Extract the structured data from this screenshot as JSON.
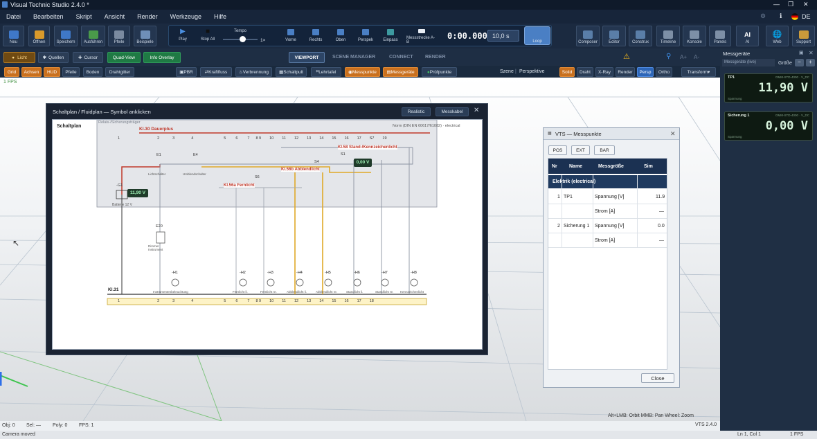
{
  "window": {
    "title": "Visual Technic Studio 2.4.0 *"
  },
  "menu": [
    "Datei",
    "Bearbeiten",
    "Skript",
    "Ansicht",
    "Render",
    "Werkzeuge",
    "Hilfe"
  ],
  "lang": "DE",
  "toolbar": {
    "left": [
      "Neu",
      "Öffnen",
      "Speichern",
      "Ausführen",
      "Pfeile",
      "Beispiele"
    ],
    "transport": [
      "Play",
      "Stop All",
      "Vorne",
      "Rechts",
      "Oben",
      "Perspek",
      "Einpass",
      "Messstrecke A-B"
    ],
    "tempo_label": "Tempo",
    "tempo_value": "1×",
    "time": "0:00.000",
    "duration": "10,0 s",
    "loop": "Loop",
    "right": [
      "Composer",
      "Editor",
      "Construx",
      "Timeline",
      "Konsole",
      "Panels",
      "AI",
      "Web",
      "Support"
    ]
  },
  "row2": {
    "licht": "Licht",
    "quellen": "Quellen",
    "cursor": "Cursor",
    "quadview": "Quad-View",
    "infooverlay": "Info Overlay",
    "tabs": [
      "VIEWPORT",
      "SCENE MANAGER",
      "CONNECT",
      "RENDER"
    ]
  },
  "row3": {
    "left": [
      "Grid",
      "Achsen",
      "HUD",
      "Pfeile",
      "Boden",
      "Drahtgitter"
    ],
    "mid": [
      "PBR",
      "Kraftfluss",
      "Verbrennung",
      "Schaltpult",
      "Lehrtafel",
      "Messpunkte",
      "Messgeräte",
      "Prüfpunkte"
    ],
    "szene": "Szene",
    "perspektive": "Perspektive",
    "modes": [
      "Solid",
      "Draht",
      "X-Ray",
      "Render",
      "Persp",
      "Ortho"
    ],
    "transform": "Transform"
  },
  "viewport": {
    "fps": "1 FPS",
    "hint": "Alt+LMB: Orbit   MMB: Pan   Wheel: Zoom",
    "version": "VTS 2.4.0"
  },
  "status": {
    "obj": "Obj: 0",
    "sel": "Sel: —",
    "poly": "Poly: 0",
    "fps": "FPS: 1",
    "message": "Camera moved",
    "lncol": "Ln 1, Col 1",
    "fps2": "1 FPS"
  },
  "panel": {
    "title": "Messgeräte",
    "size": "Größe",
    "subtitle": "Messgeräte (live)",
    "meters": [
      {
        "name": "TP1",
        "device": "DMM-STD-4000 · V_DC",
        "value": "11,90 V",
        "sub": "Spannung"
      },
      {
        "name": "Sicherung 1",
        "device": "DMM-STD-4000 · V_DC",
        "value": "0,00 V",
        "sub": "Spannung"
      }
    ]
  },
  "schematic": {
    "title": "Schaltplan / Fluidplan — Symbol anklicken",
    "btn_real": "Realistic",
    "btn_cable": "Messkabel",
    "label": "Schaltplan",
    "relay": "Relais-/Sicherungsträger",
    "norm": "Norm (DIN EN 60617/61082) · electrical",
    "kl30": "Kl.30 Dauerplus",
    "kl58": "Kl.58 Stand-/Kennzeichenlicht",
    "kl56b": "Kl.56b Abblendlicht",
    "kl56a": "Kl.56a Fernlicht",
    "kl31": "Kl.31",
    "top_nums": [
      "1",
      "2",
      "3",
      "4",
      "5",
      "6",
      "7",
      "8 9",
      "10",
      "11",
      "12",
      "13",
      "14",
      "15",
      "16",
      "17",
      "S7",
      "19"
    ],
    "bot_nums": [
      "1",
      "2",
      "3",
      "4",
      "5",
      "6",
      "7",
      "8 9",
      "10",
      "11",
      "12",
      "13",
      "14",
      "15",
      "16",
      "17",
      "18"
    ],
    "volt1": "11,90 V",
    "volt2": "0,00 V",
    "battery": "Batterie 12 V",
    "g1": "-G1",
    "switches": [
      {
        "id": "E1",
        "name": "Lichtschalter"
      },
      {
        "id": "E4",
        "name": "Umblendschalter"
      },
      {
        "id": "E20",
        "name": "Dimmer Instrument"
      }
    ],
    "fuses": [
      "S1",
      "S4",
      "S6"
    ],
    "lamps": [
      {
        "id": "-H1",
        "name": "Instrumentenbeleuchtung"
      },
      {
        "id": "-H2",
        "name": "Fernlicht li."
      },
      {
        "id": "-H3",
        "name": "Fernlicht re."
      },
      {
        "id": "-H4",
        "name": "Abblendlicht li."
      },
      {
        "id": "-H5",
        "name": "Abblendlicht re."
      },
      {
        "id": "-H6",
        "name": "Standlicht li."
      },
      {
        "id": "-H7",
        "name": "Standlicht re."
      },
      {
        "id": "-H8",
        "name": "Kennzeichenlicht"
      }
    ]
  },
  "messpunkte": {
    "title": "VTS — Messpunkte",
    "tabs": [
      "POS",
      "EXT",
      "BAR"
    ],
    "headers": [
      "Nr",
      "Name",
      "Messgröße",
      "Sim"
    ],
    "group": "Elektrik   (electrical)",
    "rows": [
      [
        "1",
        "TP1",
        "Spannung [V]",
        "11.9"
      ],
      [
        "",
        "",
        "Strom [A]",
        "—"
      ],
      [
        "2",
        "Sicherung 1",
        "Spannung [V]",
        "0.0"
      ],
      [
        "",
        "",
        "Strom [A]",
        "—"
      ]
    ],
    "close": "Close"
  }
}
